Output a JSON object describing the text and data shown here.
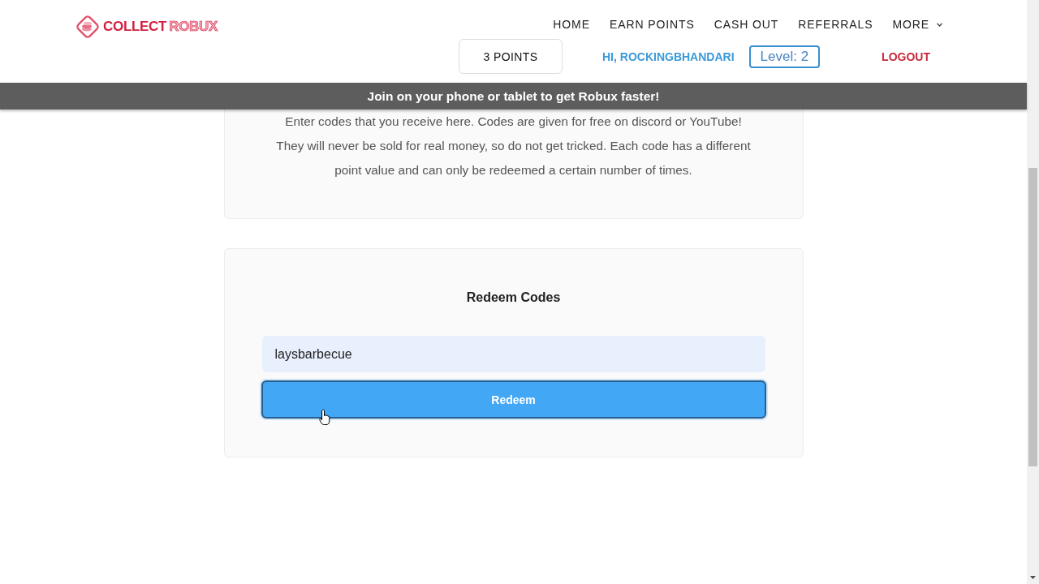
{
  "logo": {
    "words": [
      "COLLECT",
      "ROBUX"
    ]
  },
  "nav": {
    "items": [
      {
        "label": "HOME",
        "kind": "link"
      },
      {
        "label": "EARN POINTS",
        "kind": "link"
      },
      {
        "label": "CASH OUT",
        "kind": "link"
      },
      {
        "label": "REFERRALS",
        "kind": "link"
      },
      {
        "label": "MORE",
        "kind": "dropdown"
      }
    ]
  },
  "account": {
    "points": "3 POINTS",
    "greeting": "HI, ROCKINGBHANDARI",
    "level": "Level: 2",
    "logout": "LOGOUT"
  },
  "banner": {
    "text": "Join on your phone or tablet to get Robux faster!"
  },
  "info_card": {
    "text": "Enter codes that you receive here. Codes are given for free on discord or YouTube!\nThey will never be sold for real money, so do not get tricked. Each code has a different\npoint value and can only be redeemed a certain number of times."
  },
  "redeem_card": {
    "title": "Redeem Codes",
    "code_field": {
      "value": "laysbarbecue"
    },
    "button": {
      "label": "Redeem",
      "focused": true
    }
  }
}
